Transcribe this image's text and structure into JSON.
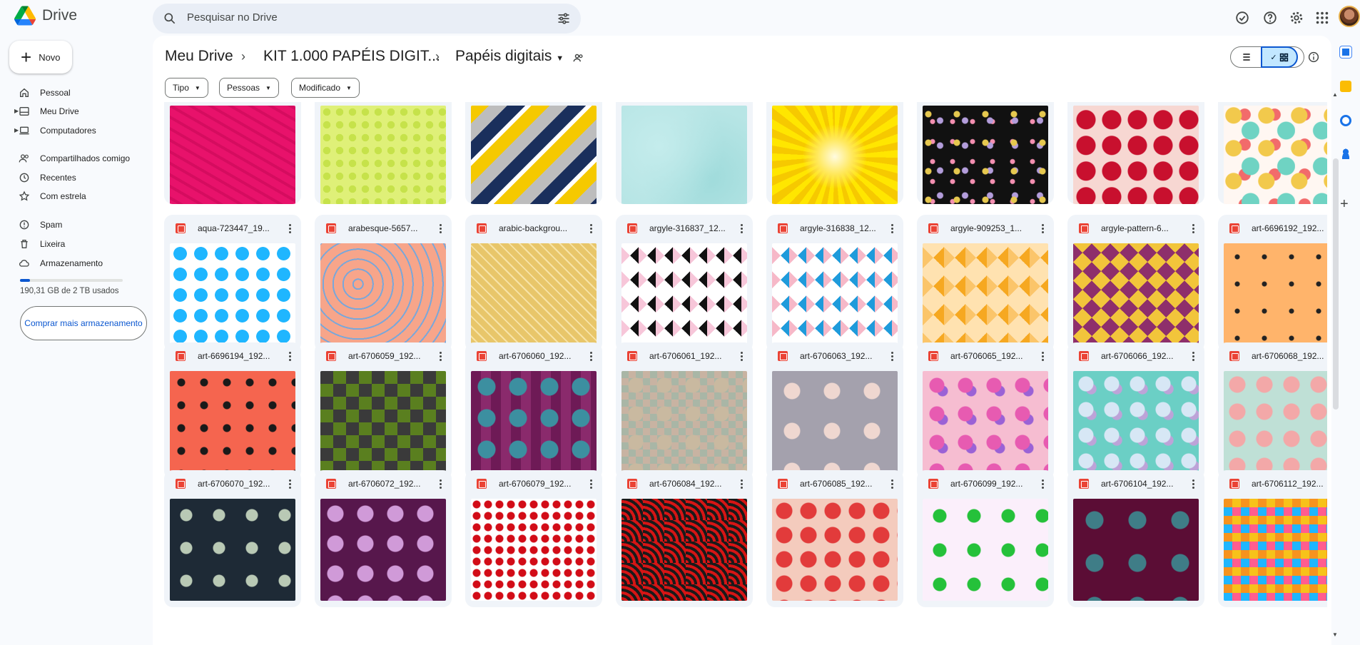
{
  "app": {
    "name": "Drive"
  },
  "search": {
    "placeholder": "Pesquisar no Drive"
  },
  "sidebar": {
    "new_label": "Novo",
    "items": [
      {
        "label": "Pessoal",
        "icon": "home-icon"
      },
      {
        "label": "Meu Drive",
        "icon": "drive-icon"
      },
      {
        "label": "Computadores",
        "icon": "computer-icon"
      },
      {
        "label": "Compartilhados comigo",
        "icon": "people-icon"
      },
      {
        "label": "Recentes",
        "icon": "clock-icon"
      },
      {
        "label": "Com estrela",
        "icon": "star-icon"
      },
      {
        "label": "Spam",
        "icon": "spam-icon"
      },
      {
        "label": "Lixeira",
        "icon": "trash-icon"
      },
      {
        "label": "Armazenamento",
        "icon": "cloud-icon"
      }
    ],
    "storage_text": "190,31 GB de 2 TB usados",
    "storage_fraction": 0.095,
    "buy_label": "Comprar mais armazenamento"
  },
  "breadcrumb": {
    "root": "Meu Drive",
    "middle": "KIT 1.000 PAPÉIS DIGIT...",
    "current": "Papéis digitais"
  },
  "filters": [
    "Tipo",
    "Pessoas",
    "Modificado"
  ],
  "files": [
    {
      "name": "",
      "pattern": "pink"
    },
    {
      "name": "",
      "pattern": "lime"
    },
    {
      "name": "",
      "pattern": "chevron"
    },
    {
      "name": "",
      "pattern": "aqua"
    },
    {
      "name": "",
      "pattern": "sunburst"
    },
    {
      "name": "",
      "pattern": "confetti"
    },
    {
      "name": "",
      "pattern": "apples"
    },
    {
      "name": "",
      "pattern": "fruits"
    },
    {
      "name": "aqua-723447_19...",
      "pattern": "hearts"
    },
    {
      "name": "arabesque-5657...",
      "pattern": "arabesque"
    },
    {
      "name": "arabic-backgrou...",
      "pattern": "gold"
    },
    {
      "name": "argyle-316837_12...",
      "pattern": "argyle-black"
    },
    {
      "name": "argyle-316838_12...",
      "pattern": "argyle-blue"
    },
    {
      "name": "argyle-909253_1...",
      "pattern": "argyle-orange"
    },
    {
      "name": "argyle-pattern-6...",
      "pattern": "argyle-purple"
    },
    {
      "name": "art-6696192_192...",
      "pattern": "sprouts"
    },
    {
      "name": "art-6696194_192...",
      "pattern": "stars-red"
    },
    {
      "name": "art-6706059_192...",
      "pattern": "flowers-green"
    },
    {
      "name": "art-6706060_192...",
      "pattern": "flowers-magenta"
    },
    {
      "name": "art-6706061_192...",
      "pattern": "flowers-checker"
    },
    {
      "name": "art-6706063_192...",
      "pattern": "flowers-grey"
    },
    {
      "name": "art-6706065_192...",
      "pattern": "flowers-pink"
    },
    {
      "name": "art-6706066_192...",
      "pattern": "flowers-teal"
    },
    {
      "name": "art-6706068_192...",
      "pattern": "flowers-peach"
    },
    {
      "name": "art-6706070_192...",
      "pattern": "dark-floral"
    },
    {
      "name": "art-6706072_192...",
      "pattern": "purple-floral"
    },
    {
      "name": "art-6706079_192...",
      "pattern": "red-dots"
    },
    {
      "name": "art-6706084_192...",
      "pattern": "red-waves"
    },
    {
      "name": "art-6706085_192...",
      "pattern": "red-roses"
    },
    {
      "name": "art-6706099_192...",
      "pattern": "green-damask"
    },
    {
      "name": "art-6706104_192...",
      "pattern": "maroon-flowers"
    },
    {
      "name": "art-6706112_192...",
      "pattern": "checker-bright"
    }
  ],
  "colors": {
    "accent": "#0b57d0",
    "selected_bg": "#c2e7ff"
  }
}
